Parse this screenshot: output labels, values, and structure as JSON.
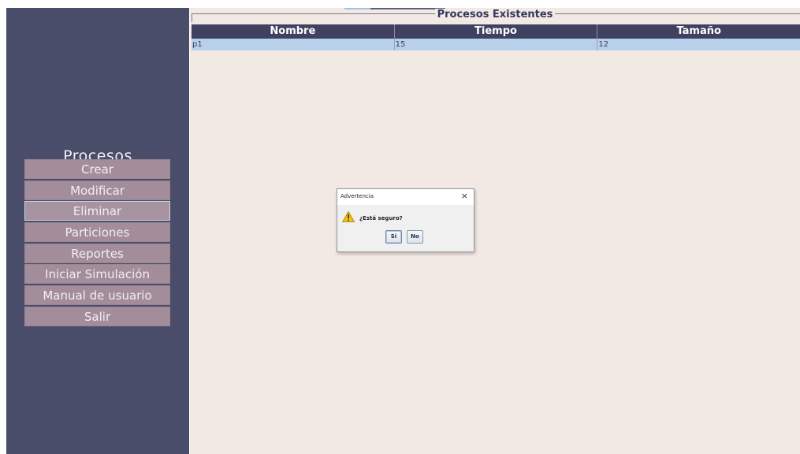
{
  "sidebar": {
    "title": "Procesos",
    "items": [
      {
        "label": "Crear"
      },
      {
        "label": "Modificar"
      },
      {
        "label": "Eliminar",
        "selected": true
      },
      {
        "label": "Particiones"
      },
      {
        "label": "Reportes"
      },
      {
        "label": "Iniciar Simulación"
      },
      {
        "label": "Manual de usuario"
      },
      {
        "label": "Salir"
      }
    ]
  },
  "main": {
    "section_title": "Procesos Existentes",
    "columns": [
      "Nombre",
      "Tiempo",
      "Tamaño"
    ],
    "rows": [
      [
        "p1",
        "15",
        "12"
      ]
    ]
  },
  "dialog": {
    "title": "Advertencia",
    "close_symbol": "×",
    "icon": "warning-icon",
    "message": "¿Está seguro?",
    "yes_label": "Si",
    "no_label": "No"
  },
  "colors": {
    "sidebar_bg": "#4a4d69",
    "menu_item_bg": "#a38d9b",
    "main_bg": "#f2e8e4",
    "table_header_bg": "#3e4260",
    "selected_row_bg": "#b8d0e9"
  }
}
